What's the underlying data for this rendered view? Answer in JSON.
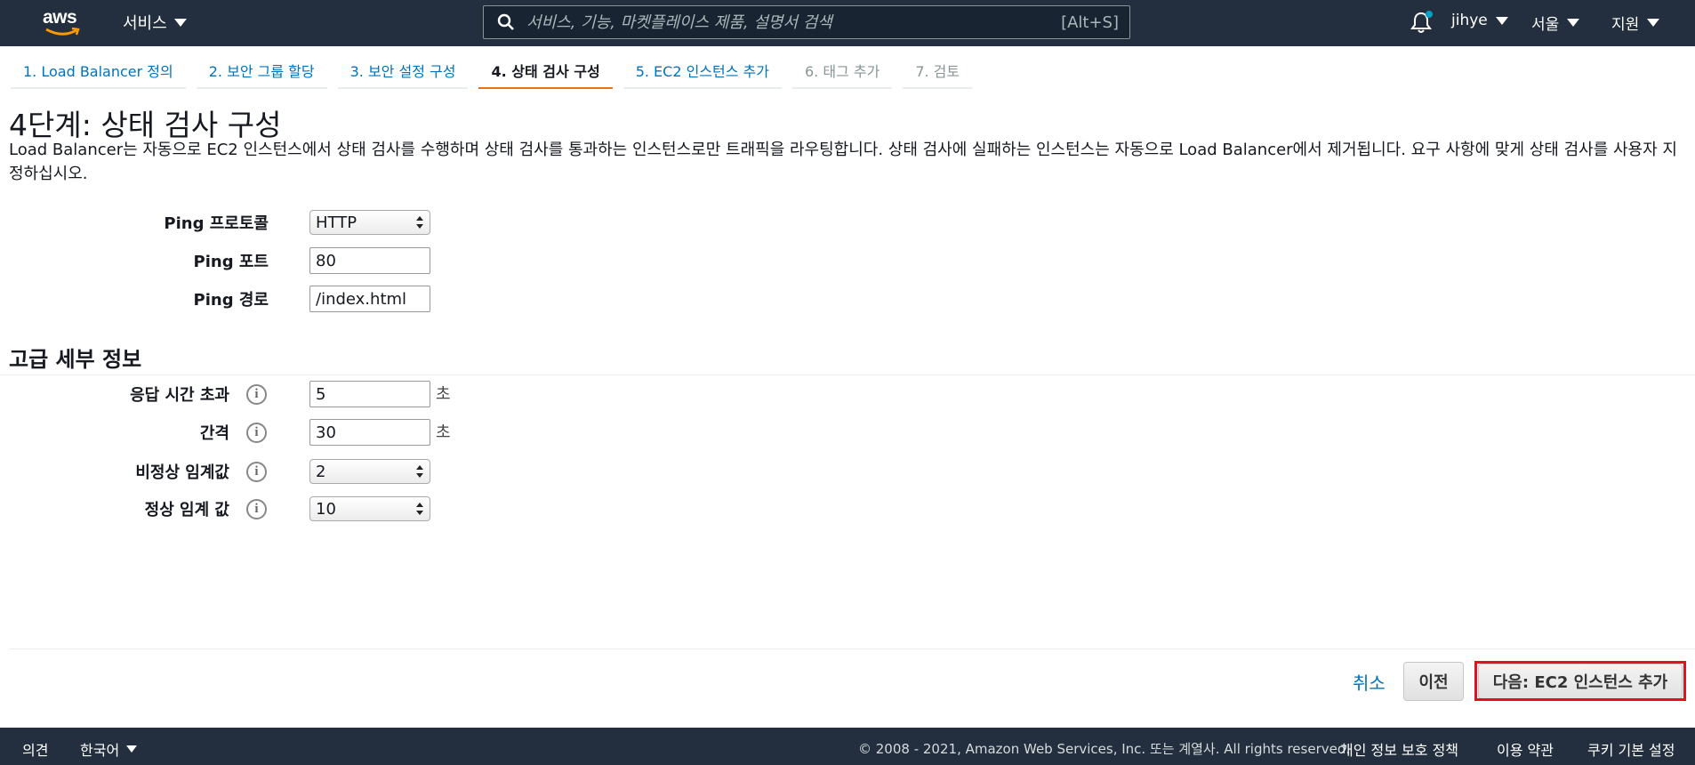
{
  "header": {
    "logo_text": "aws",
    "services_label": "서비스",
    "search": {
      "placeholder": "서비스, 기능, 마켓플레이스 제품, 설명서 검색",
      "shortcut": "[Alt+S]"
    },
    "user_label": "jihye",
    "region_label": "서울",
    "support_label": "지원"
  },
  "wizard": {
    "tabs": [
      {
        "label": "1. Load Balancer 정의",
        "state": "link"
      },
      {
        "label": "2. 보안 그룹 할당",
        "state": "link"
      },
      {
        "label": "3. 보안 설정 구성",
        "state": "link"
      },
      {
        "label": "4. 상태 검사 구성",
        "state": "active"
      },
      {
        "label": "5. EC2 인스턴스 추가",
        "state": "link"
      },
      {
        "label": "6. 태그 추가",
        "state": "disabled"
      },
      {
        "label": "7. 검토",
        "state": "disabled"
      }
    ]
  },
  "page": {
    "title": "4단계: 상태 검사 구성",
    "description": "Load Balancer는 자동으로 EC2 인스턴스에서 상태 검사를 수행하며 상태 검사를 통과하는 인스턴스로만 트래픽을 라우팅합니다. 상태 검사에 실패하는 인스턴스는 자동으로 Load Balancer에서 제거됩니다. 요구 사항에 맞게 상태 검사를 사용자 지정하십시오."
  },
  "ping": {
    "protocol_label": "Ping 프로토콜",
    "protocol_value": "HTTP",
    "port_label": "Ping 포트",
    "port_value": "80",
    "path_label": "Ping 경로",
    "path_value": "/index.html"
  },
  "advanced": {
    "title": "고급 세부 정보",
    "info_icon_text": "i",
    "timeout_label": "응답 시간 초과",
    "timeout_value": "5",
    "timeout_unit": "초",
    "interval_label": "간격",
    "interval_value": "30",
    "interval_unit": "초",
    "unhealthy_label": "비정상 임계값",
    "unhealthy_value": "2",
    "healthy_label": "정상 임계 값",
    "healthy_value": "10"
  },
  "actions": {
    "cancel_label": "취소",
    "previous_label": "이전",
    "next_label": "다음: EC2 인스턴스 추가",
    "highlight_color": "#e0121d"
  },
  "footer": {
    "feedback_label": "의견",
    "language_label": "한국어",
    "copyright": "© 2008 - 2021, Amazon Web Services, Inc. 또는 계열사. All rights reserved.",
    "privacy_label": "개인 정보 보호 정책",
    "terms_label": "이용 약관",
    "cookie_label": "쿠키 기본 설정"
  },
  "colors": {
    "nav_bg": "#232f3e",
    "link": "#0073bb",
    "active_tab_underline": "#ec7211"
  }
}
